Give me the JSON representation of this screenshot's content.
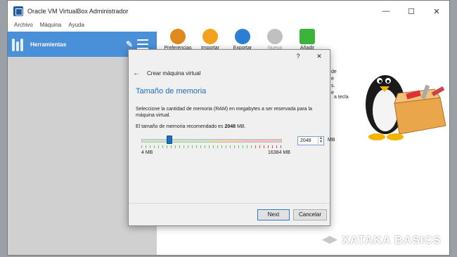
{
  "window": {
    "title": "Oracle VM VirtualBox Administrador",
    "controls": {
      "minimize": "—",
      "maximize": "☐",
      "close": "✕"
    }
  },
  "menu": [
    "Archivo",
    "Máquina",
    "Ayuda"
  ],
  "sidebar": {
    "tools_label": "Herramientas"
  },
  "toolbar": [
    {
      "label": "Preferencias",
      "icon": "preferences-icon",
      "color": "#e08a1e"
    },
    {
      "label": "Importar",
      "icon": "import-icon",
      "color": "#f2a21c"
    },
    {
      "label": "Exportar",
      "icon": "export-icon",
      "color": "#2a7fd4"
    },
    {
      "label": "Nueva",
      "icon": "new-icon",
      "color": "#c0c0c0",
      "disabled": true
    },
    {
      "label": "Añadir",
      "icon": "add-icon",
      "color": "#3cb43c"
    }
  ],
  "background_fragments": [
    "de",
    "e",
    "s.",
    "e",
    "a tecla"
  ],
  "dialog": {
    "help": "?",
    "close": "✕",
    "back": "←",
    "wizard_title": "Crear máquina virtual",
    "section_title": "Tamaño de memoria",
    "description": "Seleccione la cantidad de memoria (RAM) en megabytes a ser reservada para la máquina virtual.",
    "recommended_prefix": "El tamaño de memoria recomendado es ",
    "recommended_value": "2048",
    "recommended_suffix": " MB.",
    "memory_value": "2048",
    "memory_unit": "MB",
    "min_label": "4 MB",
    "max_label": "16384 MB",
    "buttons": {
      "next": "Next",
      "cancel": "Cancelar"
    }
  },
  "watermark": "XATAKA BASICS",
  "colors": {
    "accent": "#4a90d9",
    "section_title": "#1a6dc2",
    "slider_thumb": "#1e6ec8"
  }
}
